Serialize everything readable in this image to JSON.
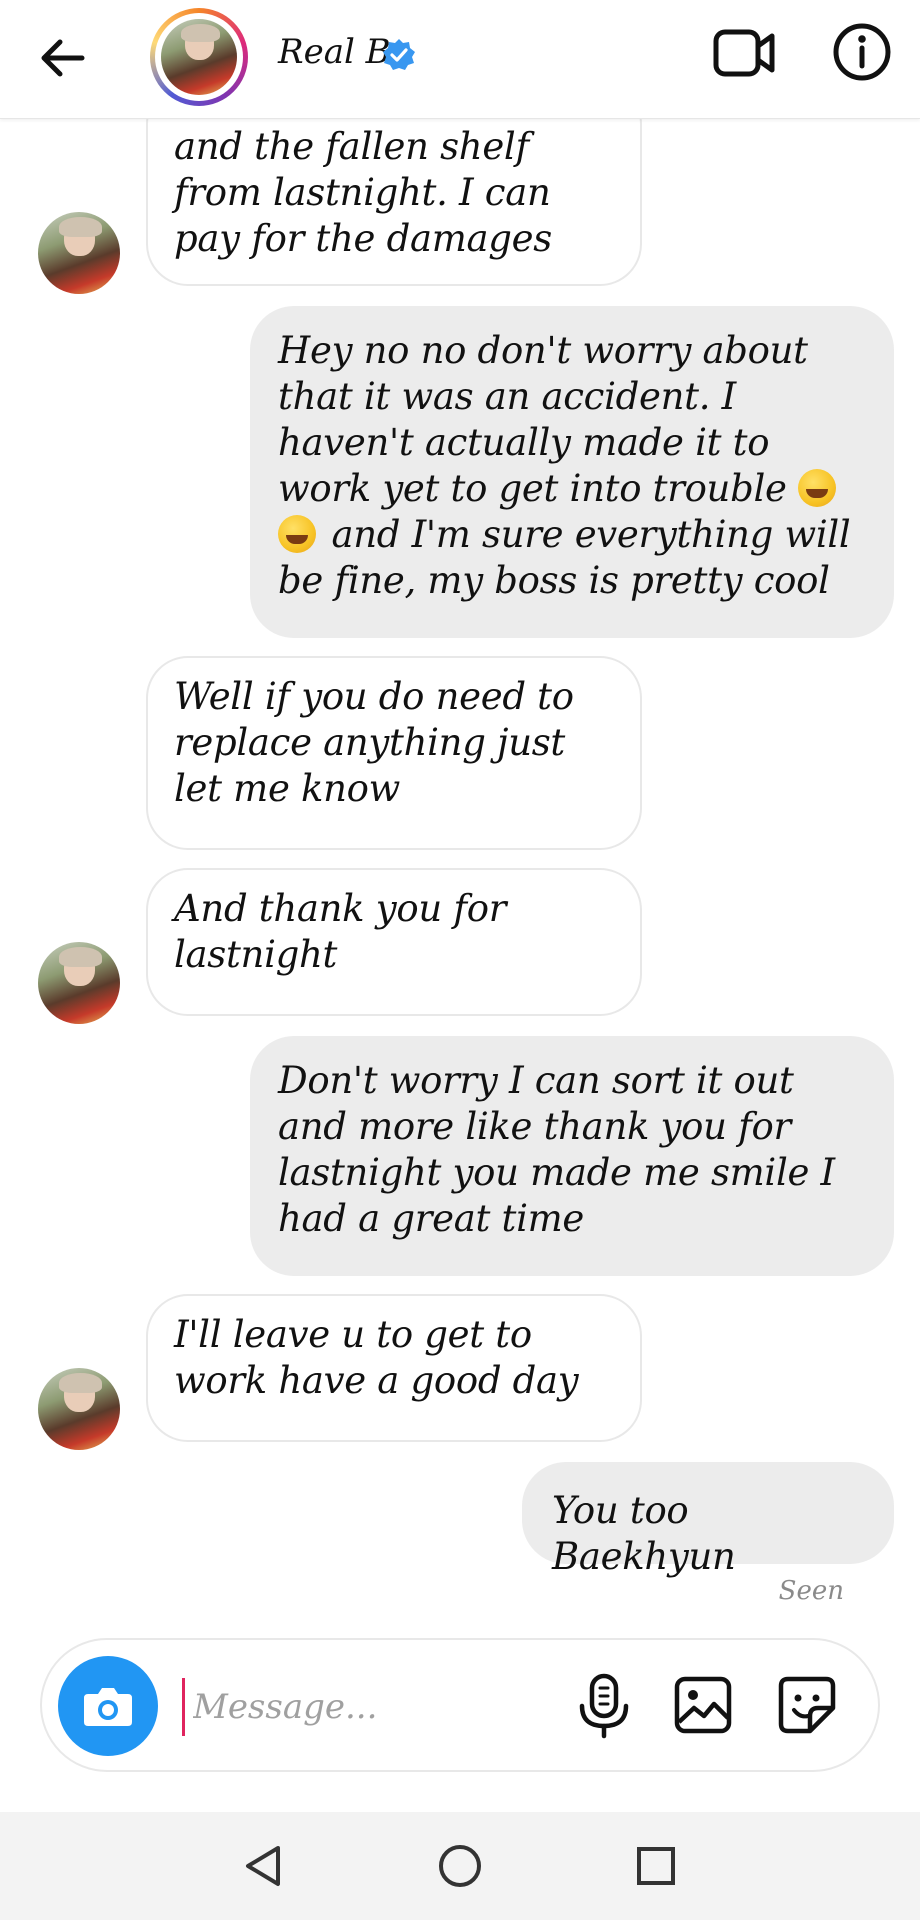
{
  "header": {
    "contact_name": "Real B",
    "verified": true,
    "icons": [
      "back-arrow-icon",
      "verified-badge-icon",
      "video-call-icon",
      "info-icon"
    ]
  },
  "messages": [
    {
      "direction": "incoming",
      "text": "and the fallen shelf from lastnight. I can pay for the damages",
      "avatar": true
    },
    {
      "direction": "outgoing",
      "text_before_emoji": "Hey no no don't worry about that it was an accident. I haven't actually made it to work yet to get into trouble",
      "emoji": "rolling-on-floor-laughing x2",
      "text_after_emoji": "and I'm sure everything will be fine, my boss is pretty cool"
    },
    {
      "direction": "incoming",
      "text": "Well if you do need to replace anything just let me know",
      "avatar": false
    },
    {
      "direction": "incoming",
      "text": "And thank you for lastnight",
      "avatar": true
    },
    {
      "direction": "outgoing",
      "text": "Don't worry I can sort it out and more like thank you for lastnight you made me smile I had a great time"
    },
    {
      "direction": "incoming",
      "text": "I'll leave u to get to work have a good day",
      "avatar": true
    },
    {
      "direction": "outgoing",
      "text": "You too Baekhyun"
    }
  ],
  "status": {
    "seen": "Seen"
  },
  "composer": {
    "placeholder": "Message...",
    "value": "",
    "icons": [
      "camera-icon",
      "microphone-icon",
      "gallery-icon",
      "sticker-icon"
    ]
  },
  "colors": {
    "camera_button": "#2196f3",
    "outgoing_bubble": "#ececec",
    "verified_badge": "#3897f0",
    "cursor": "#e0245e"
  },
  "system_nav": {
    "icons": [
      "nav-back-icon",
      "nav-home-icon",
      "nav-recents-icon"
    ]
  }
}
